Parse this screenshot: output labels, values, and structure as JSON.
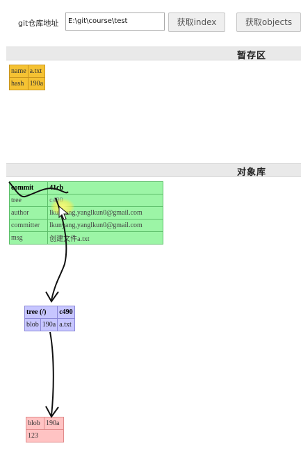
{
  "toolbar": {
    "repo_label": "git仓库地址",
    "repo_path": "E:\\git\\course\\test",
    "get_index_label": "获取index",
    "get_objects_label": "获取objects"
  },
  "sections": {
    "stage_title": "暂存区",
    "objects_title": "对象库"
  },
  "index_table": [
    {
      "key": "name",
      "value": "a.txt"
    },
    {
      "key": "hash",
      "value": "190a"
    }
  ],
  "commit_object": {
    "type": "commit",
    "id": "41cb",
    "tree_key": "tree",
    "tree_value": "c490",
    "author_key": "author",
    "author_value": "lkunyang,yanglkun0@gmail.com",
    "committer_key": "committer",
    "committer_value": "lkunyang,yanglkun0@gmail.com",
    "msg_key": "msg",
    "msg_value": "创建文件a.txt"
  },
  "tree_object": {
    "type": "tree (/)",
    "id": "c490",
    "entry_kind": "blob",
    "entry_hash": "190a",
    "entry_name": "a.txt"
  },
  "blob_object": {
    "type": "blob",
    "id": "190a",
    "content": "123"
  }
}
